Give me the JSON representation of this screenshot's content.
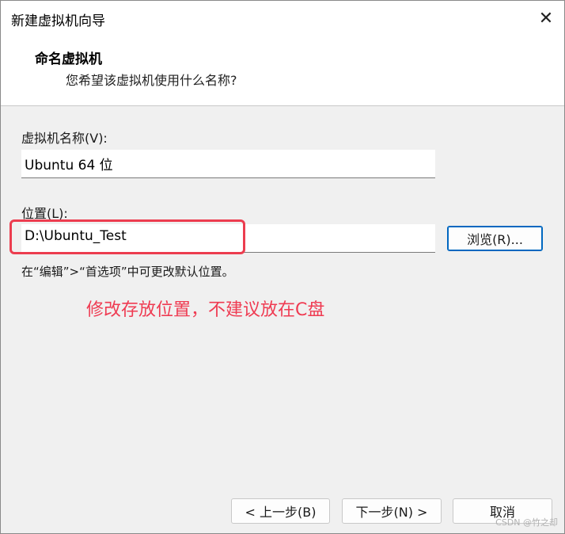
{
  "window": {
    "title": "新建虚拟机向导"
  },
  "header": {
    "title": "命名虚拟机",
    "subtitle": "您希望该虚拟机使用什么名称?"
  },
  "vm_name": {
    "label": "虚拟机名称(V):",
    "value": "Ubuntu 64 位"
  },
  "location": {
    "label": "位置(L):",
    "value": "D:\\Ubuntu_Test",
    "browse_label": "浏览(R)...",
    "hint": "在“编辑”>“首选项”中可更改默认位置。"
  },
  "annotation": {
    "text": "修改存放位置，不建议放在C盘",
    "color": "#ef3b52"
  },
  "footer": {
    "back_label": "< 上一步(B)",
    "next_label": "下一步(N) >",
    "cancel_label": "取消"
  },
  "watermark": "CSDN @竹之却",
  "icons": {
    "close": "close-icon"
  }
}
